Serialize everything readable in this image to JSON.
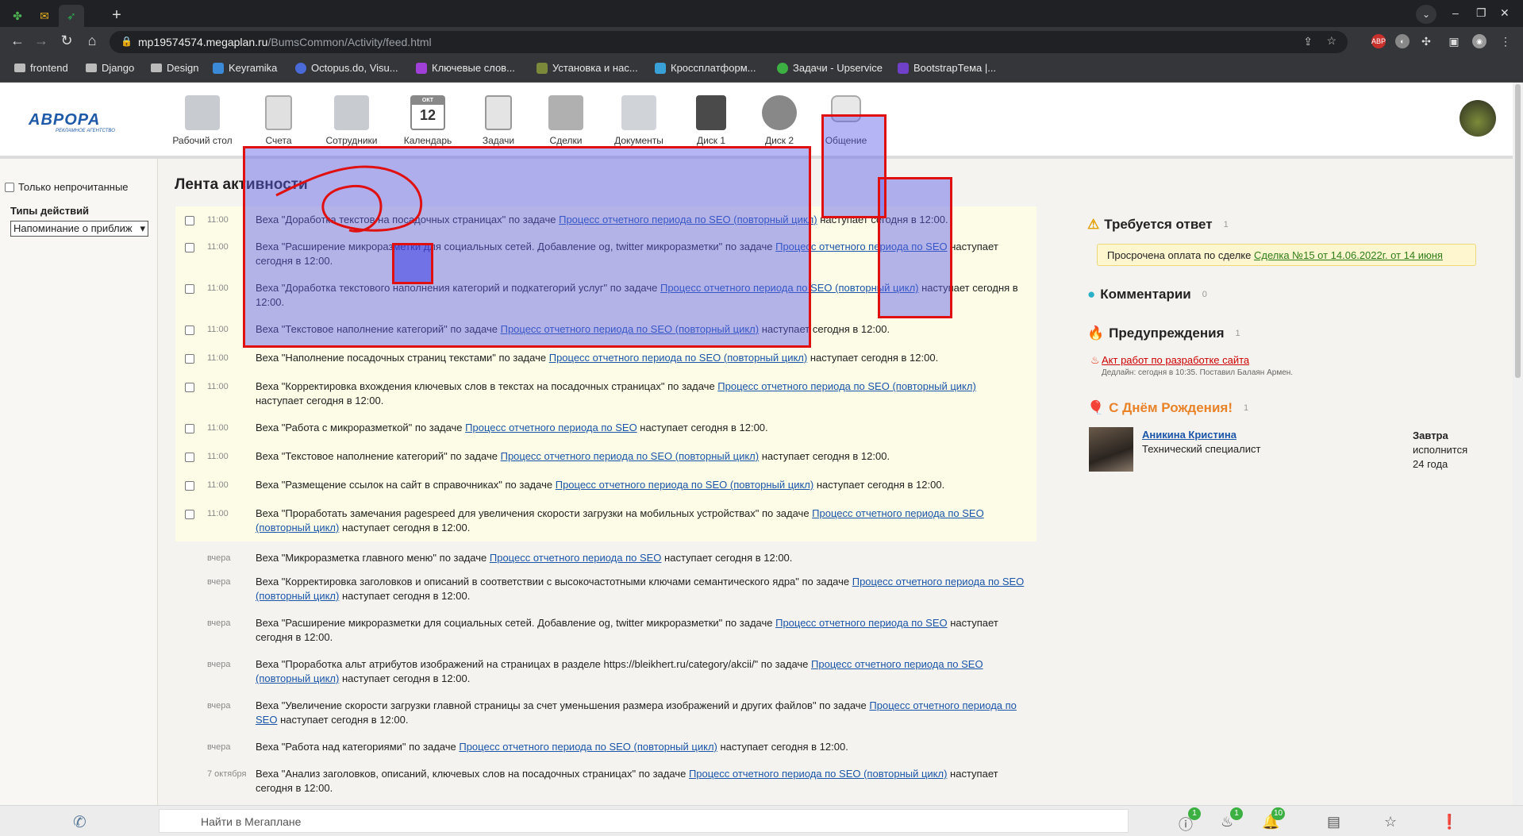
{
  "browser": {
    "url_host": "mp19574574.megaplan.ru",
    "url_path": "/BumsCommon/Activity/feed.html",
    "new_tab": "+",
    "bookmarks": [
      "frontend",
      "Django",
      "Design",
      "Keyramika",
      "Octopus.do, Visu...",
      "Ключевые слов...",
      "Установка и нас...",
      "Кроссплатформ...",
      "Задачи - Upservice",
      "BootstrapТема |..."
    ]
  },
  "app": {
    "logo": "АВРОРА",
    "logo_sub": "РЕКЛАМНОЕ АГЕНТСТВО",
    "calendar_day": "12",
    "nav": [
      "Рабочий стол",
      "Счета",
      "Сотрудники",
      "Календарь",
      "Задачи",
      "Сделки",
      "Документы",
      "Диск 1",
      "Диск 2",
      "Общение"
    ]
  },
  "left": {
    "unread_only": "Только непрочитанные",
    "action_types_label": "Типы действий",
    "action_type_selected": "Напоминание о приближ"
  },
  "feed": {
    "title": "Лента активности",
    "link_full": "Процесс отчетного периода по SEO (повторный цикл)",
    "link_short": "Процесс отчетного периода по SEO",
    "items": [
      {
        "time": "11:00",
        "pre": "Веха \"Доработка текстов на посадочных страницах\" по задаче ",
        "link": "Процесс отчетного периода по SEO (повторный цикл)",
        "post": " наступает сегодня в 12:00."
      },
      {
        "time": "11:00",
        "pre": "Веха \"Расширение микроразметки для социальных сетей. Добавление og, twitter микроразметки\" по задаче ",
        "link": "Процесс отчетного периода по SEO",
        "post": " наступает сегодня в 12:00."
      },
      {
        "time": "11:00",
        "pre": "Веха \"Доработка текстового наполнения категорий и подкатегорий услуг\" по задаче ",
        "link": "Процесс отчетного периода по SEO (повторный цикл)",
        "post": " наступает сегодня в 12:00."
      },
      {
        "time": "11:00",
        "pre": "Веха \"Текстовое наполнение категорий\" по задаче ",
        "link": "Процесс отчетного периода по SEO (повторный цикл)",
        "post": " наступает сегодня в 12:00."
      },
      {
        "time": "11:00",
        "pre": "Веха \"Наполнение посадочных страниц текстами\" по задаче ",
        "link": "Процесс отчетного периода по SEO (повторный цикл)",
        "post": " наступает сегодня в 12:00."
      },
      {
        "time": "11:00",
        "pre": "Веха \"Корректировка вхождения ключевых слов в текстах на посадочных страницах\" по задаче ",
        "link": "Процесс отчетного периода по SEO (повторный цикл)",
        "post": " наступает сегодня в 12:00."
      },
      {
        "time": "11:00",
        "pre": "Веха \"Работа с микроразметкой\" по задаче ",
        "link": "Процесс отчетного периода по SEO",
        "post": " наступает сегодня в 12:00."
      },
      {
        "time": "11:00",
        "pre": "Веха \"Текстовое наполнение категорий\" по задаче ",
        "link": "Процесс отчетного периода по SEO (повторный цикл)",
        "post": " наступает сегодня в 12:00."
      },
      {
        "time": "11:00",
        "pre": "Веха \"Размещение ссылок на сайт в справочниках\" по задаче ",
        "link": "Процесс отчетного периода по SEO (повторный цикл)",
        "post": " наступает сегодня в 12:00."
      },
      {
        "time": "11:00",
        "pre": "Веха \"Проработать замечания pagespeed для увеличения скорости загрузки на мобильных устройствах\" по задаче ",
        "link": "Процесс отчетного периода по SEO (повторный цикл)",
        "post": " наступает сегодня в 12:00."
      },
      {
        "time": "вчера",
        "pre": "Веха \"Микроразметка главного меню\" по задаче ",
        "link": "Процесс отчетного периода по SEO",
        "post": " наступает сегодня в 12:00."
      },
      {
        "time": "вчера",
        "pre": "Веха \"Корректировка заголовков и описаний в соответствии с высокочастотными ключами семантического ядра\" по задаче ",
        "link": "Процесс отчетного периода по SEO (повторный цикл)",
        "post": " наступает сегодня в 12:00."
      },
      {
        "time": "вчера",
        "pre": "Веха \"Расширение микроразметки для социальных сетей. Добавление og, twitter микроразметки\" по задаче ",
        "link": "Процесс отчетного периода по SEO",
        "post": " наступает сегодня в 12:00."
      },
      {
        "time": "вчера",
        "pre": "Веха \"Проработка альт атрибутов изображений на страницах в разделе https://bleikhert.ru/category/akcii/\" по задаче ",
        "link": "Процесс отчетного периода по SEO (повторный цикл)",
        "post": " наступает сегодня в 12:00."
      },
      {
        "time": "вчера",
        "pre": "Веха \"Увеличение скорости загрузки главной страницы за счет уменьшения размера изображений и других файлов\" по задаче ",
        "link": "Процесс отчетного периода по SEO",
        "post": " наступает сегодня в 12:00."
      },
      {
        "time": "вчера",
        "pre": "Веха \"Работа над категориями\" по задаче ",
        "link": "Процесс отчетного периода по SEO (повторный цикл)",
        "post": " наступает сегодня в 12:00."
      },
      {
        "time": "7 октября",
        "pre": "Веха \"Анализ заголовков, описаний, ключевых слов на посадочных страницах\" по задаче ",
        "link": "Процесс отчетного периода по SEO (повторный цикл)",
        "post": " наступает сегодня в 12:00."
      }
    ]
  },
  "right": {
    "reply_title": "Требуется ответ",
    "reply_count": "1",
    "reply_text": "Просрочена оплата по сделке ",
    "reply_link": "Сделка №15 от 14.06.2022г. от 14 июня",
    "comments_title": "Комментарии",
    "comments_count": "0",
    "warnings_title": "Предупреждения",
    "warnings_count": "1",
    "warning_link": "Акт работ по разработке сайта",
    "warning_meta": "Дедлайн: сегодня в 10:35. Поставил Балаян Армен.",
    "bday_title": "С Днём Рождения!",
    "bday_count": "1",
    "bday_name": "Аникина Кристина",
    "bday_role": "Технический специалист",
    "bday_when": "Завтра",
    "bday_l2": "исполнится",
    "bday_l3": "24 года"
  },
  "bottom": {
    "search_placeholder": "Найти в Мегаплане",
    "badge_alerts": "1",
    "badge_warnings": "1",
    "badge_notifications": "10"
  }
}
